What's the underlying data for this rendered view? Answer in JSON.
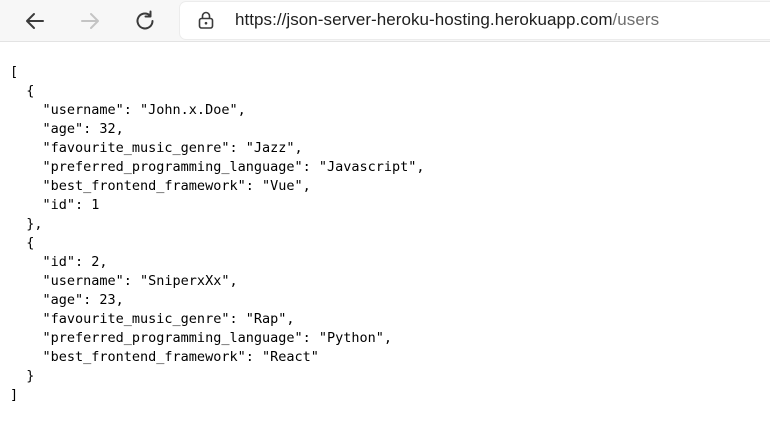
{
  "browser": {
    "url_host": "https://json-server-heroku-hosting.herokuapp.com",
    "url_path": "/users",
    "back_icon": "back-arrow-icon",
    "forward_icon": "forward-arrow-icon",
    "refresh_icon": "refresh-icon",
    "lock_icon": "lock-icon"
  },
  "json_lines": [
    "[",
    "  {",
    "    \"username\": \"John.x.Doe\",",
    "    \"age\": 32,",
    "    \"favourite_music_genre\": \"Jazz\",",
    "    \"preferred_programming_language\": \"Javascript\",",
    "    \"best_frontend_framework\": \"Vue\",",
    "    \"id\": 1",
    "  },",
    "  {",
    "    \"id\": 2,",
    "    \"username\": \"SniperxXx\",",
    "    \"age\": 23,",
    "    \"favourite_music_genre\": \"Rap\",",
    "    \"preferred_programming_language\": \"Python\",",
    "    \"best_frontend_framework\": \"React\"",
    "  }",
    "]"
  ],
  "colors": {
    "toolbar_bg": "#f7f7f7",
    "url_host": "#1f1f1f",
    "url_path": "#6e6e6e",
    "icon_active": "#3b3b3b",
    "icon_disabled": "#c4c4c4"
  }
}
